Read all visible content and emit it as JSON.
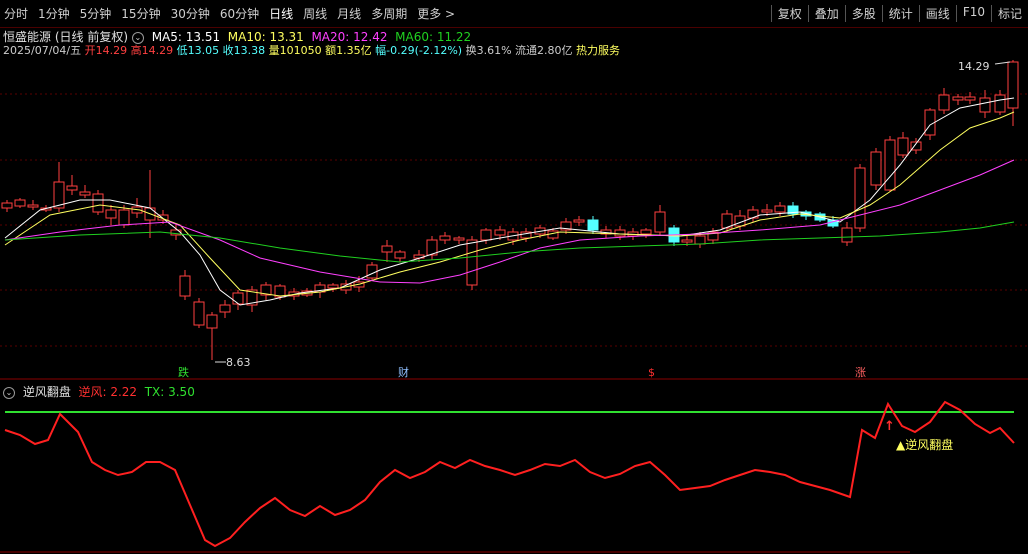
{
  "toolbar": {
    "periods": [
      "分时",
      "1分钟",
      "5分钟",
      "15分钟",
      "30分钟",
      "60分钟",
      "日线",
      "周线",
      "月线",
      "多周期",
      "更多 >"
    ],
    "active_period": "日线",
    "right_buttons": [
      "复权",
      "叠加",
      "多股",
      "统计",
      "画线",
      "F10",
      "标记"
    ]
  },
  "header": {
    "stock_name": "恒盛能源",
    "mode": "(日线 前复权)",
    "ma5": "MA5: 13.51",
    "ma10": "MA10: 13.31",
    "ma20": "MA20: 12.42",
    "ma60": "MA60: 11.22"
  },
  "info": {
    "date": "2025/07/04/五",
    "open_label": "开",
    "open": "14.29",
    "high_label": "高",
    "high": "14.29",
    "low_label": "低",
    "low": "13.05",
    "close_label": "收",
    "close": "13.38",
    "vol_label": "量",
    "vol": "101050",
    "amount_label": "额",
    "amount": "1.35亿",
    "change_label": "幅",
    "change": "-0.29(-2.12%)",
    "turnover": "换3.61%",
    "float_cap": "流通2.80亿",
    "sector": "热力服务"
  },
  "indicator": {
    "name": "逆风翻盘",
    "v1_label": "逆风: 2.22",
    "v2_label": "TX: 3.50",
    "signal_text": "逆风翻盘"
  },
  "price_labels": {
    "high": "14.29",
    "low": "8.63"
  },
  "event_markers": [
    "跌",
    "财",
    "$",
    "涨"
  ],
  "colors": {
    "up": "#ff4040",
    "down": "#54ffff",
    "ma5": "#ffffff",
    "ma10": "#ffff60",
    "ma20": "#ff40ff",
    "ma60": "#20d020",
    "ind": "#ff2020",
    "tx": "#30e030"
  }
}
